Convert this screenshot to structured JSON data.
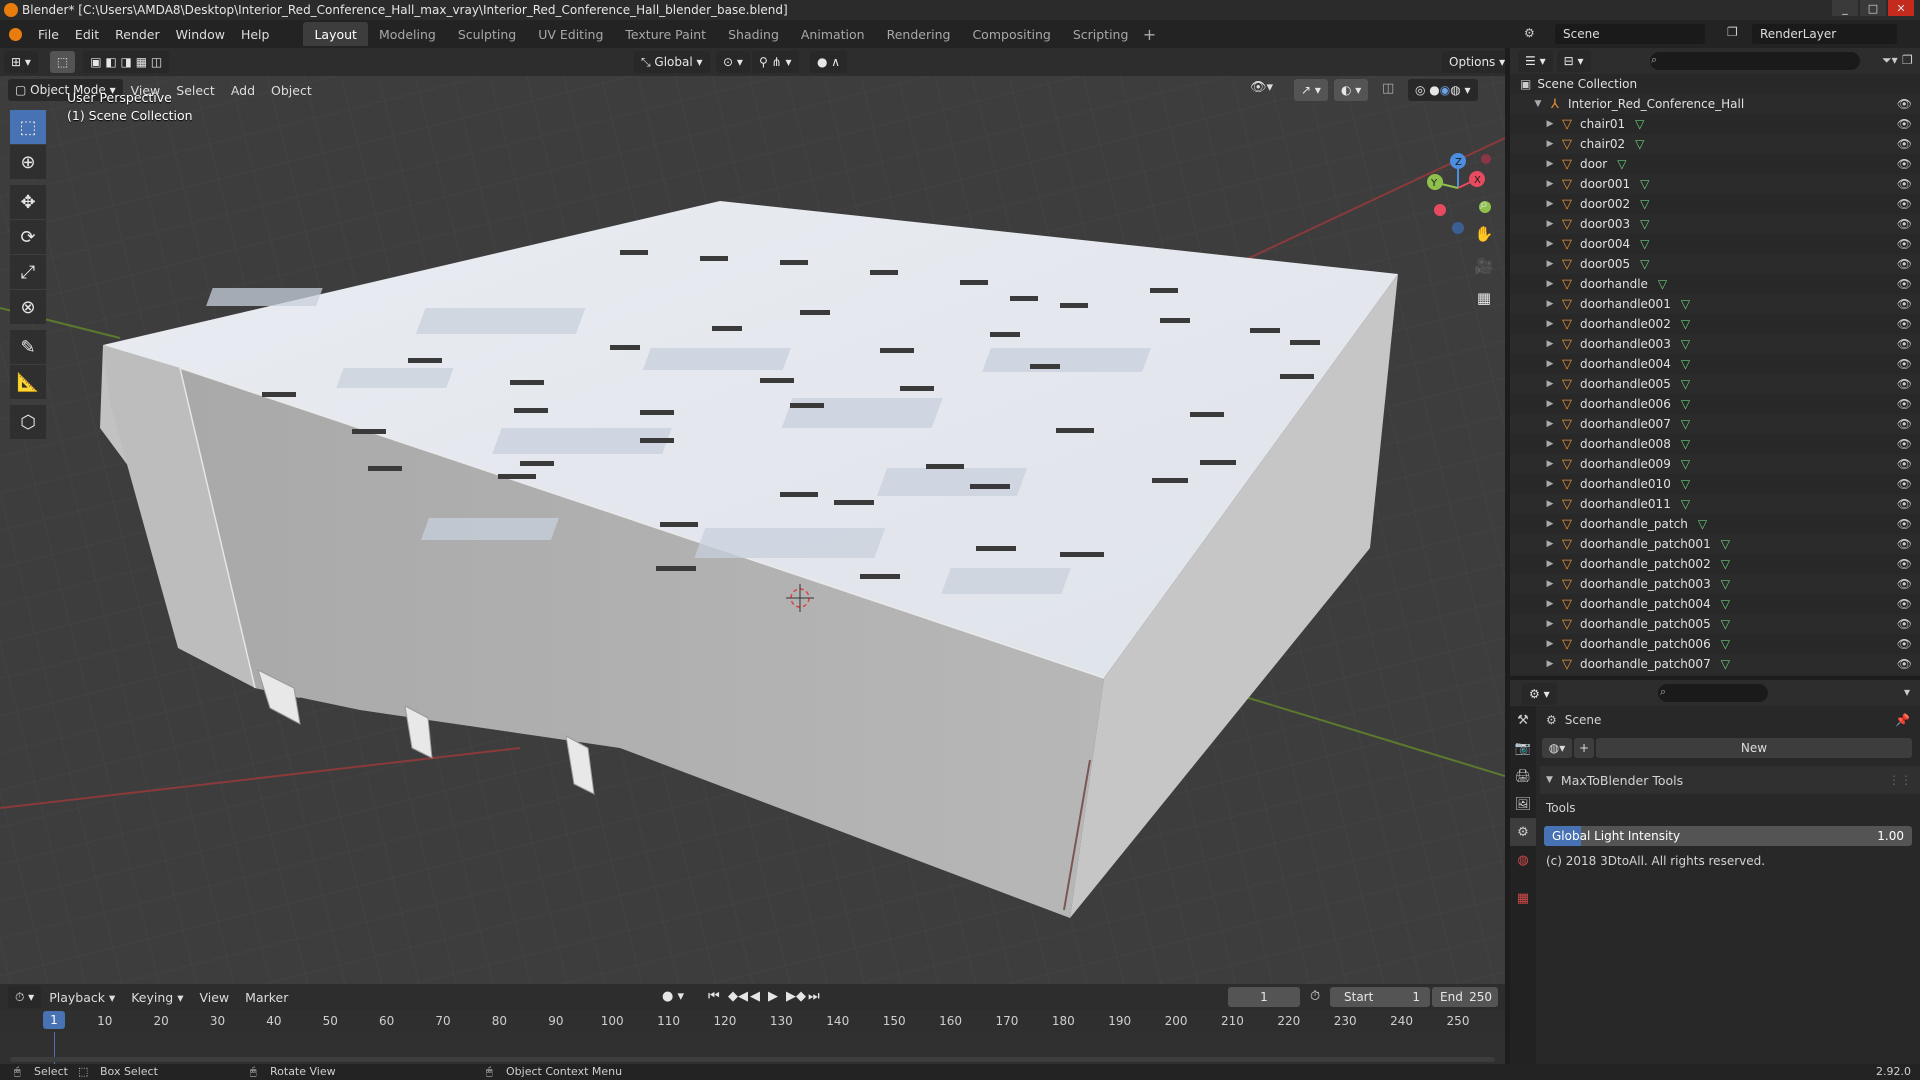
{
  "window": {
    "title": "Blender* [C:\\Users\\AMDA8\\Desktop\\Interior_Red_Conference_Hall_max_vray\\Interior_Red_Conference_Hall_blender_base.blend]",
    "controls": [
      "_",
      "□",
      "✕"
    ]
  },
  "menu": [
    "File",
    "Edit",
    "Render",
    "Window",
    "Help"
  ],
  "workspaces": [
    "Layout",
    "Modeling",
    "Sculpting",
    "UV Editing",
    "Texture Paint",
    "Shading",
    "Animation",
    "Rendering",
    "Compositing",
    "Scripting"
  ],
  "active_workspace": "Layout",
  "add_workspace_symbol": "+",
  "scene_selector": "Scene",
  "view_layer": "RenderLayer",
  "viewport": {
    "transform_orientation": "Global",
    "options_label": "Options",
    "mode": "Object Mode",
    "header_menus": [
      "View",
      "Select",
      "Add",
      "Object"
    ],
    "info_line1": "User Perspective",
    "info_line2": "(1) Scene Collection",
    "gizmo_axes": {
      "x": "X",
      "y": "Y",
      "z": "Z"
    },
    "axis_colors": {
      "x": "#e84a5f",
      "y": "#8fc04c",
      "z": "#4c8fe0"
    }
  },
  "outliner": {
    "search_placeholder": "",
    "root": "Scene Collection",
    "collection": "Interior_Red_Conference_Hall",
    "items": [
      "chair01",
      "chair02",
      "door",
      "door001",
      "door002",
      "door003",
      "door004",
      "door005",
      "doorhandle",
      "doorhandle001",
      "doorhandle002",
      "doorhandle003",
      "doorhandle004",
      "doorhandle005",
      "doorhandle006",
      "doorhandle007",
      "doorhandle008",
      "doorhandle009",
      "doorhandle010",
      "doorhandle011",
      "doorhandle_patch",
      "doorhandle_patch001",
      "doorhandle_patch002",
      "doorhandle_patch003",
      "doorhandle_patch004",
      "doorhandle_patch005",
      "doorhandle_patch006",
      "doorhandle_patch007"
    ]
  },
  "properties": {
    "context": "Scene",
    "new_label": "New",
    "panel_title": "MaxToBlender Tools",
    "tools_label": "Tools",
    "slider_label": "Global Light Intensity",
    "slider_value": "1.00",
    "slider_fraction": 0.1,
    "copyright": "(c) 2018 3DtoAll. All rights reserved."
  },
  "timeline": {
    "menus": [
      "Playback",
      "Keying",
      "View",
      "Marker"
    ],
    "current_frame": "1",
    "start_label": "Start",
    "start_value": "1",
    "end_label": "End",
    "end_value": "250",
    "ruler": [
      "10",
      "20",
      "30",
      "40",
      "50",
      "60",
      "70",
      "80",
      "90",
      "100",
      "110",
      "120",
      "130",
      "140",
      "150",
      "160",
      "170",
      "180",
      "190",
      "200",
      "210",
      "220",
      "230",
      "240",
      "250"
    ],
    "playhead": "1"
  },
  "statusbar": {
    "select": "Select",
    "box_select": "Box Select",
    "rotate": "Rotate View",
    "context_menu": "Object Context Menu",
    "version": "2.92.0"
  }
}
